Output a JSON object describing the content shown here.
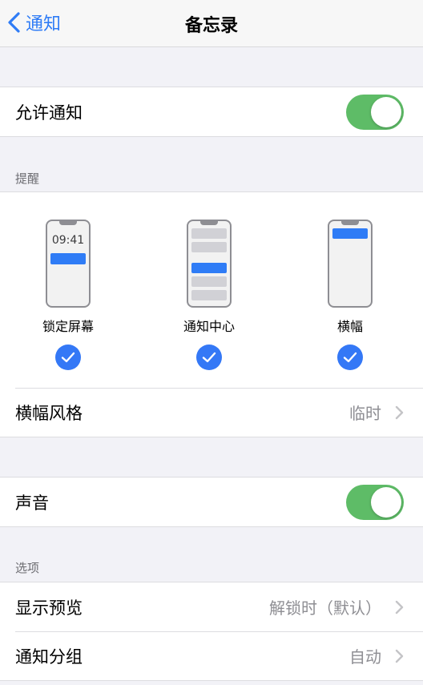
{
  "nav": {
    "back_label": "通知",
    "title": "备忘录"
  },
  "allow": {
    "label": "允许通知",
    "enabled": true
  },
  "alerts": {
    "header": "提醒",
    "lock_screen": {
      "label": "锁定屏幕",
      "time": "09:41",
      "checked": true
    },
    "notification_center": {
      "label": "通知中心",
      "checked": true
    },
    "banners": {
      "label": "横幅",
      "checked": true
    },
    "banner_style": {
      "label": "横幅风格",
      "value": "临时"
    }
  },
  "sound": {
    "label": "声音",
    "enabled": true
  },
  "options": {
    "header": "选项",
    "show_previews": {
      "label": "显示预览",
      "value": "解锁时（默认）"
    },
    "notification_grouping": {
      "label": "通知分组",
      "value": "自动"
    }
  },
  "colors": {
    "accent": "#2f7cf6",
    "toggle_on": "#5ebc67",
    "secondary_text": "#8e8e93"
  }
}
